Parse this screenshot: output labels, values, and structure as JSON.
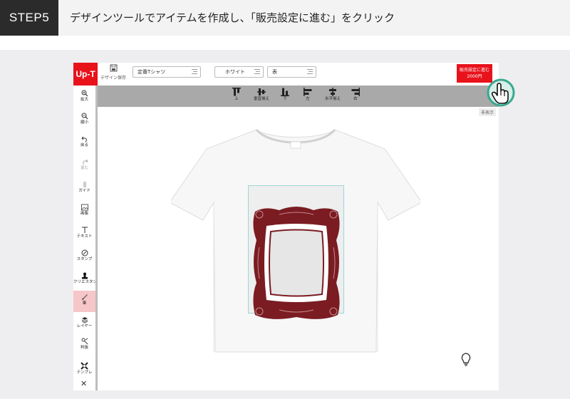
{
  "banner": {
    "step_label": "STEP5",
    "instruction": "デザインツールでアイテムを作成し、「販売設定に進む」をクリック"
  },
  "app": {
    "logo": "Up-T",
    "topbar": {
      "save_label": "デザイン保存",
      "item_select": "定番Tシャツ",
      "color_select": "ホワイト",
      "side_select": "表",
      "next_button_line1": "販売設定に進む",
      "next_button_line2": "2000円"
    },
    "align_toolbar": [
      "上",
      "垂直揃え",
      "下",
      "左",
      "水平揃え",
      "右"
    ],
    "hide_label": "非表示",
    "sidebar": [
      {
        "label": "拡大",
        "icon": "zoom-in-icon"
      },
      {
        "label": "縮小",
        "icon": "zoom-out-icon"
      },
      {
        "label": "戻る",
        "icon": "undo-icon"
      },
      {
        "label": "進む",
        "icon": "redo-icon"
      },
      {
        "label": "ガイド",
        "icon": "guide-icon"
      },
      {
        "label": "画像",
        "icon": "image-icon"
      },
      {
        "label": "テキスト",
        "icon": "text-icon"
      },
      {
        "label": "スタンプ",
        "icon": "stamp-icon"
      },
      {
        "label": "クリエスタンプ",
        "icon": "creator-stamp-icon"
      },
      {
        "label": "筆",
        "icon": "brush-icon"
      },
      {
        "label": "レイヤー",
        "icon": "layers-icon"
      },
      {
        "label": "判抜",
        "icon": "cut-icon"
      },
      {
        "label": "テンプレ",
        "icon": "template-icon"
      }
    ],
    "colors": {
      "brand_red": "#e8121b",
      "frame_color": "#7a1c22",
      "toolbar_gray": "#a9a9a9"
    }
  }
}
